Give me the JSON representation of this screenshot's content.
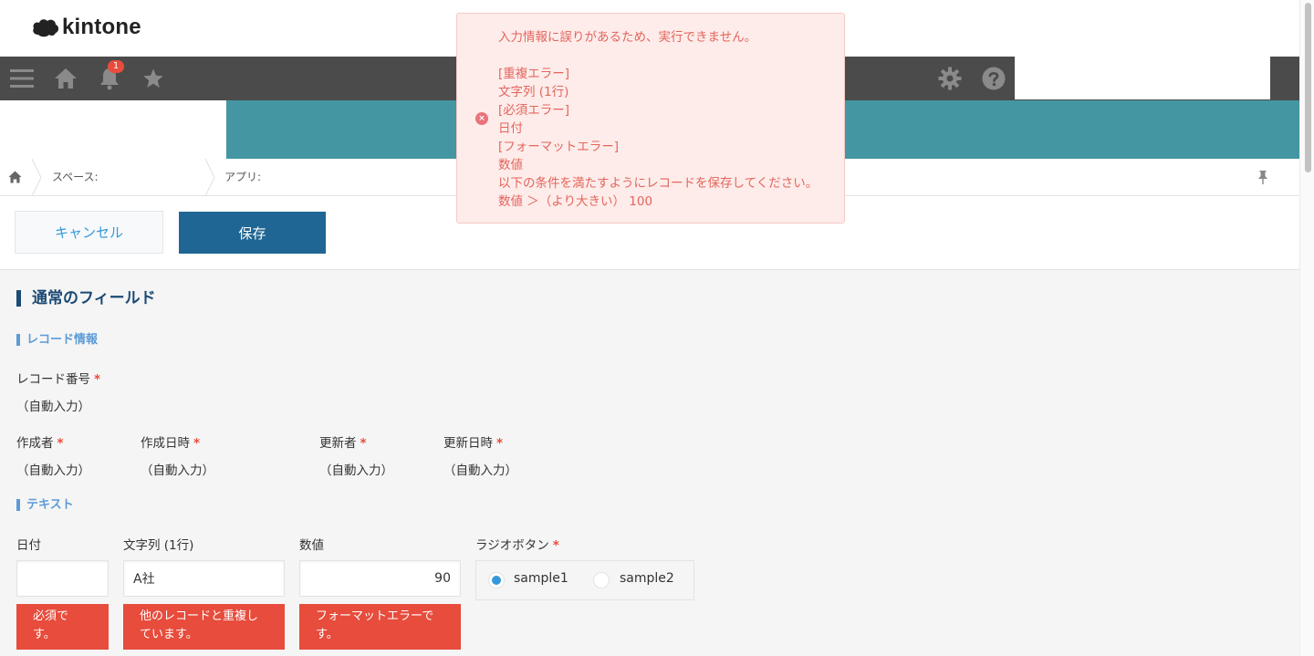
{
  "app": {
    "logo_text": "kintone"
  },
  "nav": {
    "notification_count": "1"
  },
  "breadcrumb": {
    "space_label": "スペース:",
    "app_label": "アプリ:"
  },
  "toolbar": {
    "cancel_label": "キャンセル",
    "save_label": "保存"
  },
  "form": {
    "section_title": "通常のフィールド",
    "groups": {
      "record_info": "レコード情報",
      "text": "テキスト"
    },
    "required_mark": "*",
    "record_number": {
      "label": "レコード番号",
      "value": "（自動入力）"
    },
    "creator": {
      "label": "作成者",
      "value": "（自動入力）"
    },
    "created_at": {
      "label": "作成日時",
      "value": "（自動入力）"
    },
    "updater": {
      "label": "更新者",
      "value": "（自動入力）"
    },
    "updated_at": {
      "label": "更新日時",
      "value": "（自動入力）"
    },
    "date": {
      "label": "日付",
      "value": "",
      "error": [
        "必須で",
        "す。"
      ]
    },
    "text_single": {
      "label": "文字列 (1行)",
      "value": "A社",
      "error": [
        "他のレコードと重複し",
        "ています。"
      ]
    },
    "number": {
      "label": "数値",
      "value": "90",
      "error": [
        "フォーマットエラーで",
        "す。"
      ]
    },
    "radio": {
      "label": "ラジオボタン",
      "options": [
        "sample1",
        "sample2"
      ],
      "selected": "sample1"
    }
  },
  "toast": {
    "lines": [
      "入力情報に誤りがあるため、実行できません。",
      "",
      "[重複エラー]",
      "文字列 (1行)",
      "[必須エラー]",
      "日付",
      "[フォーマットエラー]",
      "数値",
      "以下の条件を満たすようにレコードを保存してください。",
      "数値 ＞（より大きい） 100"
    ]
  },
  "colors": {
    "nav_bg": "#4b4b4b",
    "banner": "#4396a2",
    "save_button": "#206694",
    "error": "#e74c3c",
    "toast_bg": "#fdecea",
    "toast_text": "#e4655c",
    "section_title": "#1c4a74",
    "group_title": "#5d9bd7"
  }
}
